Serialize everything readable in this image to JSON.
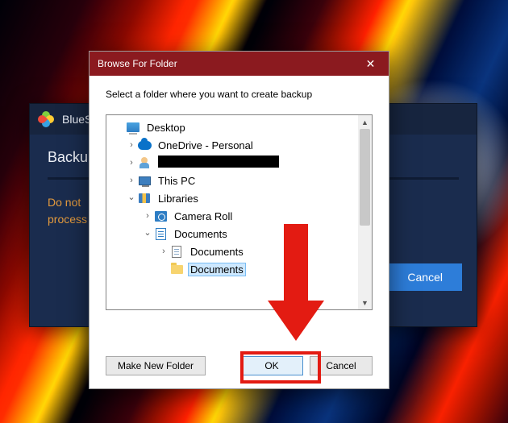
{
  "bluestacks": {
    "title": "BlueStacks",
    "heading": "Backup",
    "warning_l1": "Do not",
    "warning_l2": "process",
    "cancel": "Cancel"
  },
  "dialog": {
    "title": "Browse For Folder",
    "instruction": "Select a folder where you want to create backup",
    "make_new": "Make New Folder",
    "ok": "OK",
    "cancel": "Cancel"
  },
  "tree": {
    "n0": "Desktop",
    "n1": "OneDrive - Personal",
    "n2_redacted": true,
    "n3": "This PC",
    "n4": "Libraries",
    "n5": "Camera Roll",
    "n6": "Documents",
    "n7": "Documents",
    "n8": "Documents"
  }
}
